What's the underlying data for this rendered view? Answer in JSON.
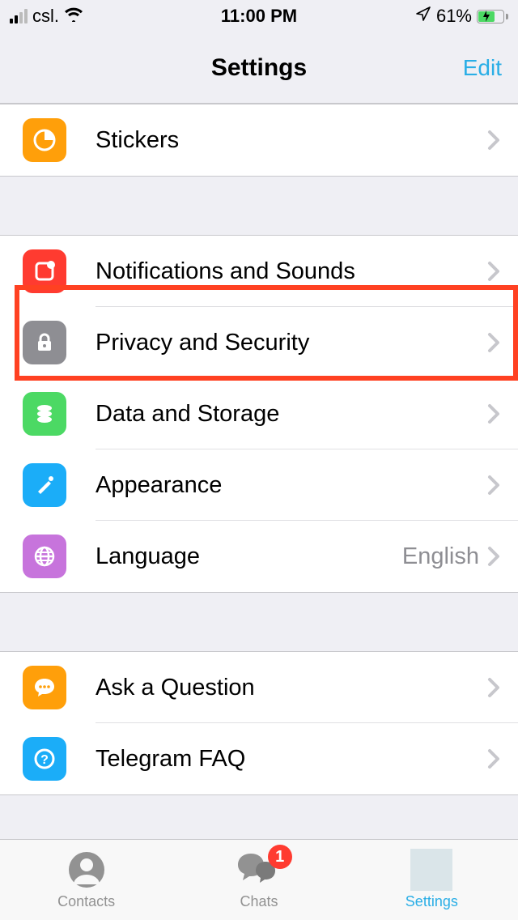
{
  "status": {
    "carrier": "csl.",
    "time": "11:00 PM",
    "battery_pct": "61%"
  },
  "header": {
    "title": "Settings",
    "edit": "Edit"
  },
  "sections": [
    {
      "rows": [
        {
          "key": "stickers",
          "label": "Stickers",
          "icon": "stickers-icon",
          "color": "#ff9f0a"
        }
      ]
    },
    {
      "rows": [
        {
          "key": "notifications",
          "label": "Notifications and Sounds",
          "icon": "bell-icon",
          "color": "#ff3b30"
        },
        {
          "key": "privacy",
          "label": "Privacy and Security",
          "icon": "lock-icon",
          "color": "#8e8e93"
        },
        {
          "key": "data",
          "label": "Data and Storage",
          "icon": "database-icon",
          "color": "#4cd964"
        },
        {
          "key": "appearance",
          "label": "Appearance",
          "icon": "brush-icon",
          "color": "#1badf8"
        },
        {
          "key": "language",
          "label": "Language",
          "icon": "globe-icon",
          "color": "#c774dc",
          "value": "English"
        }
      ]
    },
    {
      "rows": [
        {
          "key": "ask",
          "label": "Ask a Question",
          "icon": "chat-icon",
          "color": "#ff9f0a"
        },
        {
          "key": "faq",
          "label": "Telegram FAQ",
          "icon": "help-icon",
          "color": "#1badf8"
        }
      ]
    }
  ],
  "tabs": {
    "contacts": "Contacts",
    "chats": "Chats",
    "chats_badge": "1",
    "settings": "Settings"
  },
  "highlight": "privacy"
}
